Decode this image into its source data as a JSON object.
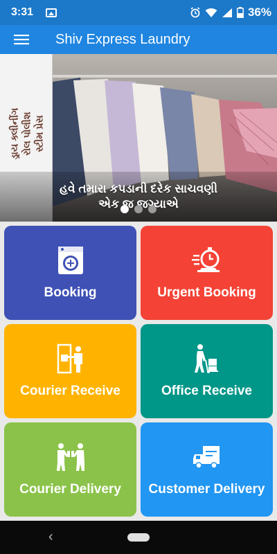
{
  "status_bar": {
    "time": "3:31",
    "battery": "36%"
  },
  "app_bar": {
    "title": "Shiv Express Laundry"
  },
  "banner": {
    "side_lines": [
      "ડ્રાય ક્લીનીંગ",
      "રોલ પોલીશ",
      "સ્ટીમ પ્રેસ"
    ],
    "caption_line1": "હવે તમારા કપડાની દરેક સાચવણી",
    "caption_line2": "એક જ જગ્યાએ",
    "slides": 3,
    "active_slide": 1
  },
  "tiles": [
    {
      "label": "Booking",
      "color": "#3f51b5",
      "icon": "washing-machine-icon"
    },
    {
      "label": "Urgent Booking",
      "color": "#f44336",
      "icon": "timer-delivery-icon"
    },
    {
      "label": "Courier Receive",
      "color": "#ffb300",
      "icon": "courier-receive-icon"
    },
    {
      "label": "Office Receive",
      "color": "#009688",
      "icon": "hand-truck-icon"
    },
    {
      "label": "Courier Delivery",
      "color": "#8bc34a",
      "icon": "handover-icon"
    },
    {
      "label": "Customer Delivery",
      "color": "#2196f3",
      "icon": "delivery-truck-icon"
    }
  ],
  "colors": {
    "status_bar": "#1c78c8",
    "app_bar": "#1f85e0",
    "background": "#e9e9e9"
  }
}
